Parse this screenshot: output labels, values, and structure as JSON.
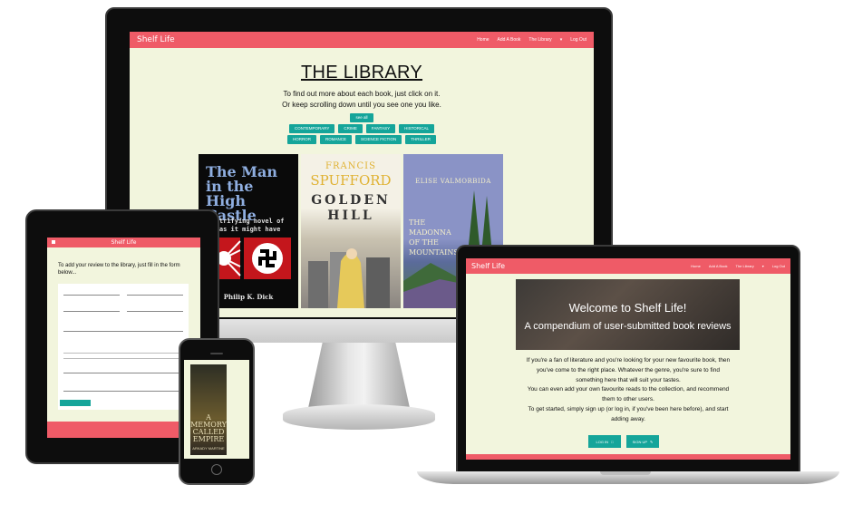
{
  "brand": "Shelf Life",
  "nav": {
    "home": "Home",
    "add_book": "Add A Book",
    "library": "The Library",
    "caret": "▾",
    "logout": "Log Out"
  },
  "desktop": {
    "title": "THE LIBRARY",
    "subtitle_1": "To find out more about each book, just click on it.",
    "subtitle_2": "Or keep scrolling down until you see one you like.",
    "filter_all": "see all",
    "filters_row1": [
      "CONTEMPORARY",
      "CRIME",
      "FANTASY",
      "HISTORICAL"
    ],
    "filters_row2": [
      "HORROR",
      "ROMANCE",
      "SCIENCE FICTION",
      "THRILLER"
    ],
    "books": [
      {
        "title": "The Man in the High Castle",
        "tagline": "electrifying novel of our as it might have been",
        "author": "Philip K. Dick"
      },
      {
        "author_first": "FRANCIS",
        "author_last": "SPUFFORD",
        "title": "GOLDEN HILL"
      },
      {
        "author": "ELISE VALMORBIDA",
        "title": "THE MADONNA OF THE MOUNTAINS"
      }
    ]
  },
  "tablet": {
    "heading": "To add your review to the library, just fill in the form below..."
  },
  "phone": {
    "book_title": "A MEMORY CALLED EMPIRE",
    "book_author": "ARKADY MARTINE"
  },
  "laptop": {
    "hero_title": "Welcome to Shelf Life!",
    "hero_subtitle": "A compendium of user-submitted book reviews",
    "body_lines": [
      "If you're a fan of literature and you're looking for your new favourite book, then",
      "you've come to the right place. Whatever the genre, you're sure to find",
      "something here that will suit your tastes.",
      "You can even add your own favourite reads to the collection, and recommend",
      "them to other users.",
      "To get started, simply sign up (or log in, if you've been here before), and start",
      "adding away."
    ],
    "login_label": "LOG IN",
    "signup_label": "SIGN UP"
  },
  "colors": {
    "brand_coral": "#ef5b67",
    "accent_teal": "#15a59a",
    "page_cream": "#f2f5dd"
  }
}
